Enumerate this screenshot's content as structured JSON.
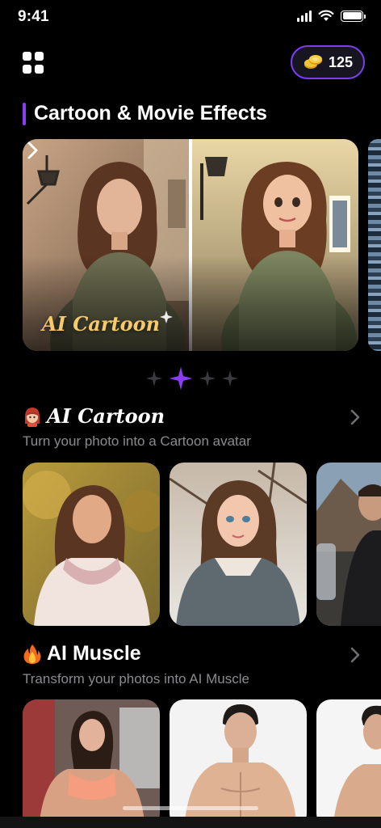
{
  "status_bar": {
    "time": "9:41"
  },
  "header": {
    "coins": "125"
  },
  "featured": {
    "title": "Cartoon & Movie Effects",
    "banner_label": "AI Cartoon",
    "pages": 4,
    "active_page": 2
  },
  "sections": [
    {
      "title": "AI Cartoon",
      "emoji_icon": "girl-avatar-icon",
      "subtitle": "Turn your photo into a Cartoon avatar"
    },
    {
      "title": "AI Muscle",
      "emoji_icon": "fire-icon",
      "subtitle": "Transform your photos into AI Muscle"
    }
  ],
  "colors": {
    "accent": "#8d3cf5",
    "banner_label": "#f6c96b",
    "subtitle": "#8a8a8f"
  }
}
